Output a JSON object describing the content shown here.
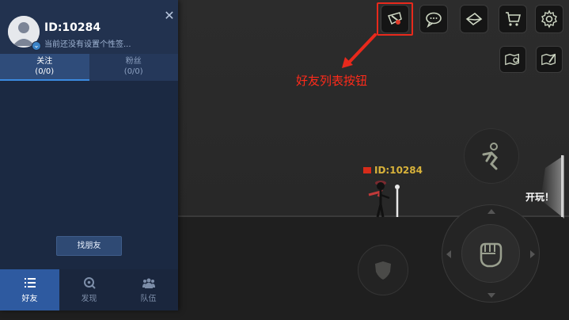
{
  "panel": {
    "user_id": "ID:10284",
    "signature": "当前还没有设置个性签...",
    "close_icon": "close-icon",
    "tabs": [
      {
        "label": "关注",
        "count": "(0/0)",
        "active": true
      },
      {
        "label": "粉丝",
        "count": "(0/0)",
        "active": false
      }
    ],
    "find_friend_label": "找朋友",
    "nav": [
      {
        "label": "好友",
        "icon": "list-icon",
        "active": true
      },
      {
        "label": "发现",
        "icon": "discover-icon",
        "active": false
      },
      {
        "label": "队伍",
        "icon": "team-icon",
        "active": false
      }
    ]
  },
  "hud": {
    "top_buttons": [
      {
        "name": "friend-list-icon"
      },
      {
        "name": "chat-icon"
      },
      {
        "name": "mail-icon"
      },
      {
        "name": "shop-cart-icon"
      },
      {
        "name": "settings-gear-icon"
      }
    ],
    "side_buttons": [
      {
        "name": "map-pin-icon"
      },
      {
        "name": "map-edit-icon"
      }
    ],
    "annotation": "好友列表按钮",
    "annotation_color": "#ff2a1a",
    "player_id": "ID:10284",
    "player_id_color": "#d8b23a",
    "start_label": "开玩！"
  }
}
